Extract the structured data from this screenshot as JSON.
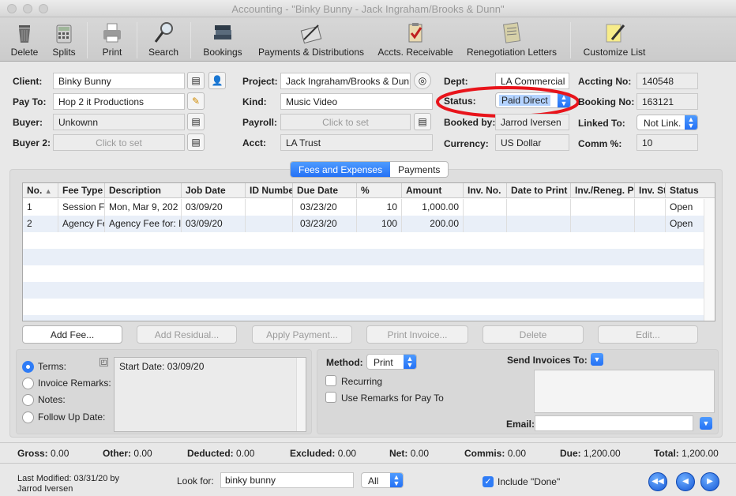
{
  "window": {
    "title": "Accounting - \"Binky Bunny - Jack Ingraham/Brooks & Dunn\""
  },
  "toolbar": [
    {
      "label": "Delete",
      "icon": "trash-icon"
    },
    {
      "label": "Splits",
      "icon": "calculator-icon"
    },
    {
      "label": "Print",
      "icon": "printer-icon"
    },
    {
      "label": "Search",
      "icon": "magnifier-icon"
    },
    {
      "label": "Bookings",
      "icon": "books-icon"
    },
    {
      "label": "Payments & Distributions",
      "icon": "payments-icon"
    },
    {
      "label": "Accts. Receivable",
      "icon": "clipboard-check-icon"
    },
    {
      "label": "Renegotiation Letters",
      "icon": "letter-icon"
    },
    {
      "label": "Customize List",
      "icon": "notepad-pencil-icon"
    }
  ],
  "form": {
    "client_label": "Client:",
    "client": "Binky Bunny",
    "payto_label": "Pay To:",
    "payto": "Hop 2 it Productions",
    "buyer_label": "Buyer:",
    "buyer": "Unkownn",
    "buyer2_label": "Buyer 2:",
    "buyer2_placeholder": "Click to set",
    "project_label": "Project:",
    "project": "Jack Ingraham/Brooks & Dunn",
    "kind_label": "Kind:",
    "kind": "Music Video",
    "payroll_label": "Payroll:",
    "payroll_placeholder": "Click to set",
    "acct_label": "Acct:",
    "acct": "LA Trust",
    "dept_label": "Dept:",
    "dept": "LA Commercial",
    "status_label": "Status:",
    "status": "Paid Direct",
    "bookedby_label": "Booked by:",
    "bookedby": "Jarrod Iversen",
    "currency_label": "Currency:",
    "currency": "US Dollar",
    "accting_label": "Accting No:",
    "accting": "140548",
    "booking_label": "Booking No:",
    "booking": "163121",
    "linked_label": "Linked To:",
    "linked": "Not Link.",
    "comm_label": "Comm %:",
    "comm": "10"
  },
  "tabs": [
    "Fees and Expenses",
    "Payments"
  ],
  "table": {
    "columns": [
      "No.",
      "Fee Type",
      "Description",
      "Job Date",
      "ID Numbe",
      "Due Date",
      "%",
      "Amount",
      "Inv. No.",
      "Date to Print",
      "Inv./Reneg. P",
      "Inv. St",
      "Status"
    ],
    "rows": [
      [
        "1",
        "Session F",
        "Mon, Mar 9, 202",
        "03/09/20",
        "",
        "03/23/20",
        "10",
        "1,000.00",
        "",
        "",
        "",
        "",
        "Open"
      ],
      [
        "2",
        "Agency Fe",
        "Agency Fee for: I",
        "03/09/20",
        "",
        "03/23/20",
        "100",
        "200.00",
        "",
        "",
        "",
        "",
        "Open"
      ]
    ]
  },
  "buttons": {
    "add_fee": "Add Fee...",
    "add_residual": "Add Residual...",
    "apply_payment": "Apply Payment...",
    "print_invoice": "Print Invoice...",
    "delete": "Delete",
    "edit": "Edit..."
  },
  "options": {
    "terms": "Terms:",
    "invoice_remarks": "Invoice Remarks:",
    "notes": "Notes:",
    "follow_up": "Follow Up Date:",
    "notes_text": "Start Date: 03/09/20"
  },
  "invoice": {
    "method_label": "Method:",
    "method": "Print",
    "recurring": "Recurring",
    "use_remarks": "Use Remarks for Pay To",
    "send_label": "Send Invoices To:",
    "email_label": "Email:"
  },
  "totals": {
    "gross": "Gross:",
    "gross_v": "0.00",
    "other": "Other:",
    "other_v": "0.00",
    "deducted": "Deducted:",
    "deducted_v": "0.00",
    "excluded": "Excluded:",
    "excluded_v": "0.00",
    "net": "Net:",
    "net_v": "0.00",
    "commis": "Commis:",
    "commis_v": "0.00",
    "due": "Due:",
    "due_v": "1,200.00",
    "total": "Total:",
    "total_v": "1,200.00"
  },
  "footer": {
    "modified_line1": "Last Modified: 03/31/20 by",
    "modified_line2": "Jarrod Iversen",
    "lookfor_label": "Look for:",
    "lookfor": "binky bunny",
    "scope": "All",
    "include_done": "Include \"Done\""
  }
}
